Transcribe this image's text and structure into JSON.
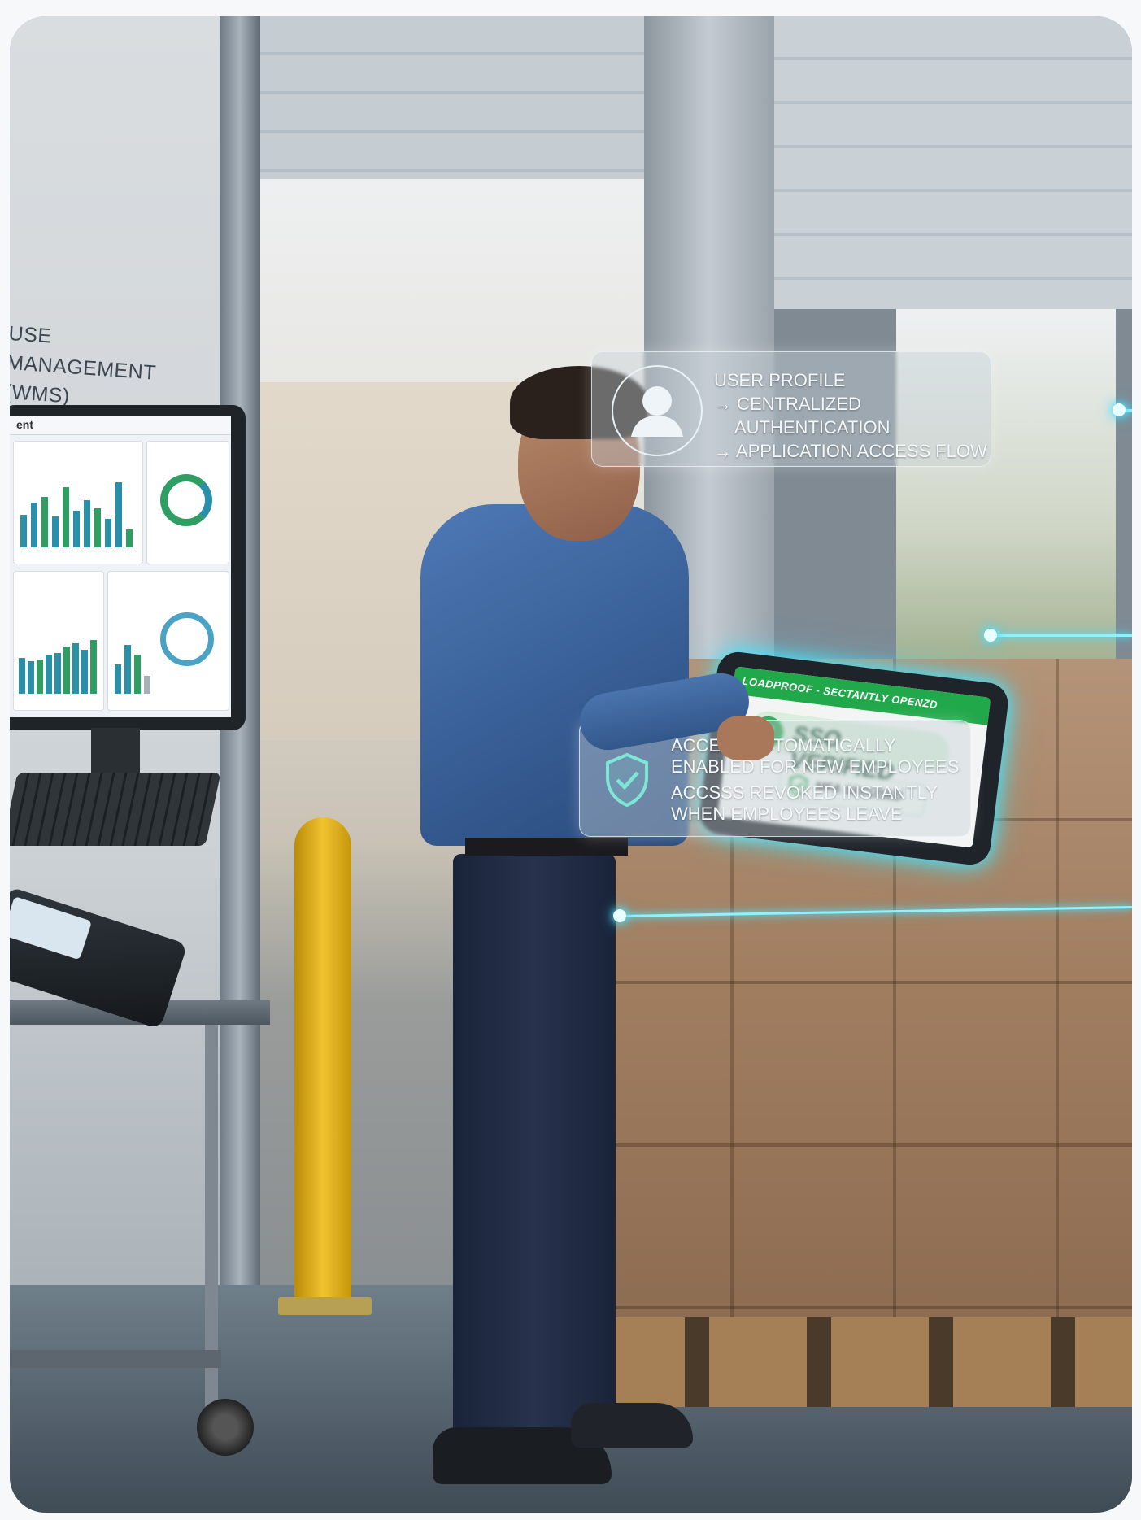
{
  "wms": {
    "title_line1": "USE MANAGEMENT",
    "title_line2": "(WMS) DASHBOARD",
    "header_text": "ent"
  },
  "profile_card": {
    "line1": "USER PROFILE",
    "line2": "→ CENTRALIZED",
    "line3": "AUTHENTICATION",
    "line4": "→ APPLICATION ACCESS FLOW",
    "icon": "user-avatar-icon"
  },
  "tablet": {
    "header": "LOADPROOF - SECTANTLY OPENZD",
    "sso_label": "SSO VERIFIED",
    "mfa_label": "MFA SECUSED",
    "accent_color": "#24a24c"
  },
  "access_card": {
    "line1": "ACCESS AUTOMATIGALLY",
    "line2": "ENABLED FOR NEW EMPLOYEES",
    "line3": "ACCSSS REVOKED INSTANTLY",
    "line4": "WHEN EMPLOYEES LEAVE",
    "icon": "shield-check-icon",
    "icon_color": "#7fe6d6"
  },
  "glow_color": "#8ff2ff"
}
